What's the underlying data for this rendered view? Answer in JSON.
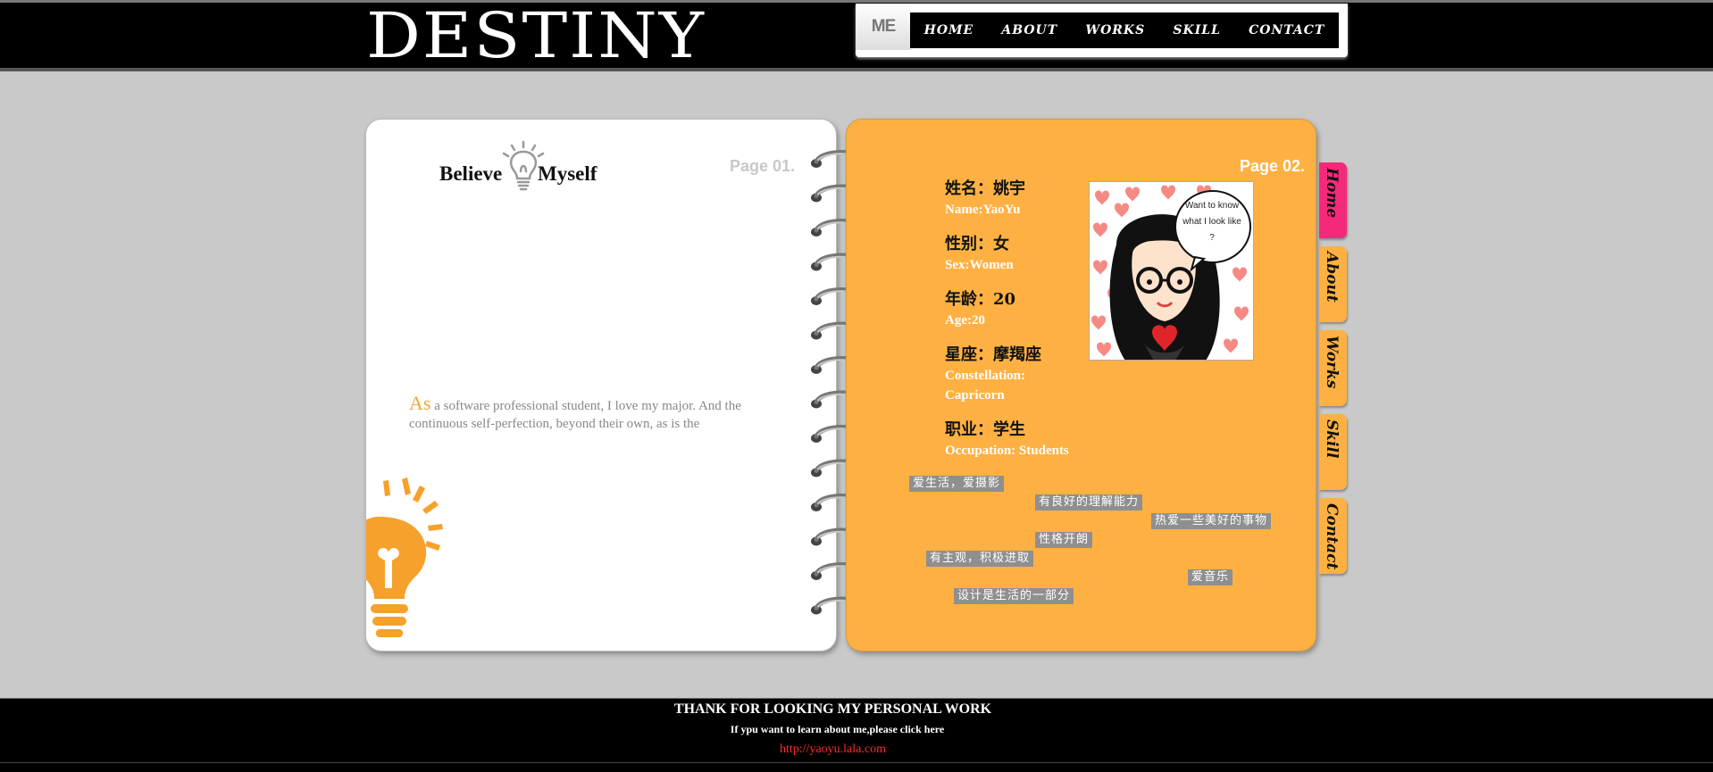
{
  "header": {
    "logo": "DESTINY",
    "me_tab": "ME",
    "nav": [
      "HOME",
      "ABOUT",
      "WORKS",
      "SKILL",
      "CONTACT"
    ]
  },
  "left_page": {
    "page_label": "Page 01.",
    "title_left": "Believe",
    "title_right": "Myself",
    "intro_initial": "As",
    "intro_text": " a software professional student, I love my major. And the continuous self-perfection, beyond their own, as is the"
  },
  "right_page": {
    "page_label": "Page 02.",
    "info": [
      {
        "cn": "姓名：姚宇",
        "en": [
          "Name:YaoYu"
        ]
      },
      {
        "cn": "性别：女",
        "en": [
          "Sex:Women"
        ]
      },
      {
        "cn": "年龄：20",
        "en": [
          "Age:20"
        ]
      },
      {
        "cn": "星座：摩羯座",
        "en": [
          "Constellation:",
          "Capricorn"
        ]
      },
      {
        "cn": "职业：学生",
        "en": [
          "Occupation: Students"
        ]
      }
    ],
    "avatar_bubble": [
      "Want to know",
      "what I look like",
      "?"
    ],
    "tags": [
      "爱生活，爱摄影",
      "有良好的理解能力",
      "热爱一些美好的事物",
      "性格开朗",
      "有主观，积极进取",
      "爱音乐",
      "设计是生活的一部分"
    ]
  },
  "side_tabs": [
    {
      "label": "Home",
      "color": "#f5297a"
    },
    {
      "label": "About",
      "color": "#feb142"
    },
    {
      "label": "Works",
      "color": "#feb142"
    },
    {
      "label": "Skill",
      "color": "#feb142"
    },
    {
      "label": "Contact",
      "color": "#feb142"
    }
  ],
  "footer": {
    "title": "THANK FOR LOOKING MY PERSONAL WORK",
    "subtitle": "If ypu want to learn about me,please click here",
    "link": "http://yaoyu.lala.com"
  }
}
